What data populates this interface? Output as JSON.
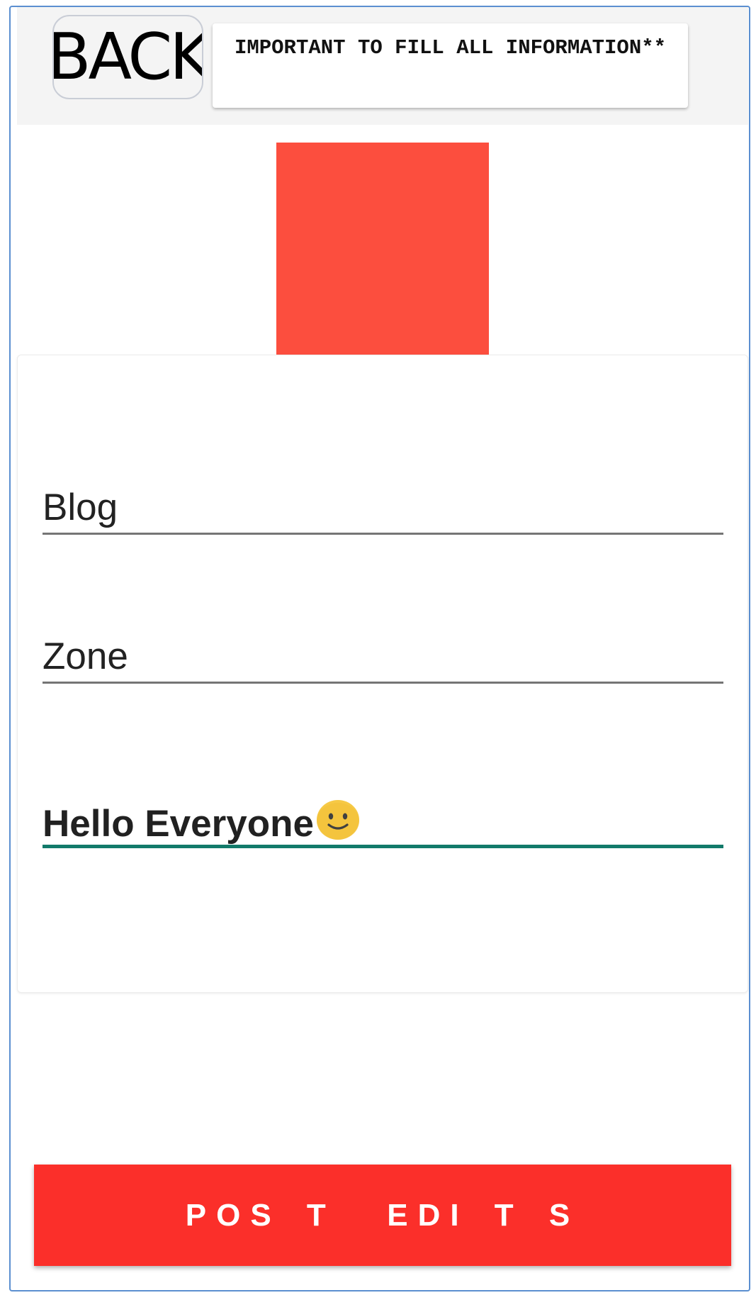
{
  "header": {
    "back_label": "BACK",
    "notice": "IMPORTANT TO FILL ALL INFORMATION**"
  },
  "image": {
    "color": "#fc4e3e"
  },
  "form": {
    "blog_value": "Blog",
    "zone_value": "Zone",
    "message_value": "Hello Everyone",
    "message_icon": "smiley-emoji-icon"
  },
  "actions": {
    "post_label": "POS T  EDI T S"
  },
  "colors": {
    "accent": "#127a6a",
    "button": "#fb2f2a",
    "frame_border": "#5b8fd0"
  }
}
